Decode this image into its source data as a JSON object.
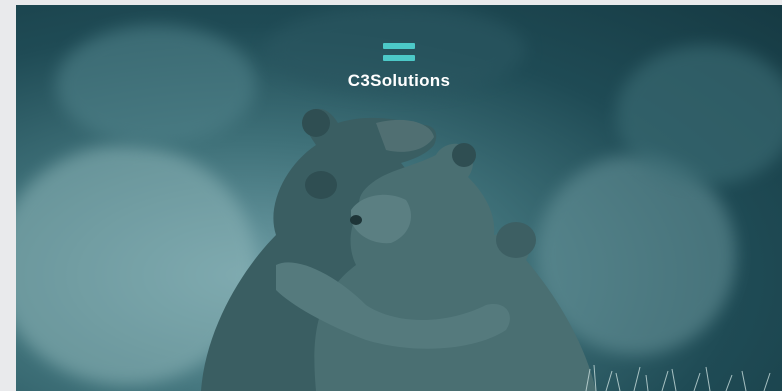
{
  "brand": {
    "name": "C3Solutions",
    "logo_icon": "equals-bars-icon",
    "accent_color": "#4cc9c8"
  },
  "hero": {
    "image_subject": "two-bears-hugging",
    "tint_color": "#2f6b73"
  }
}
